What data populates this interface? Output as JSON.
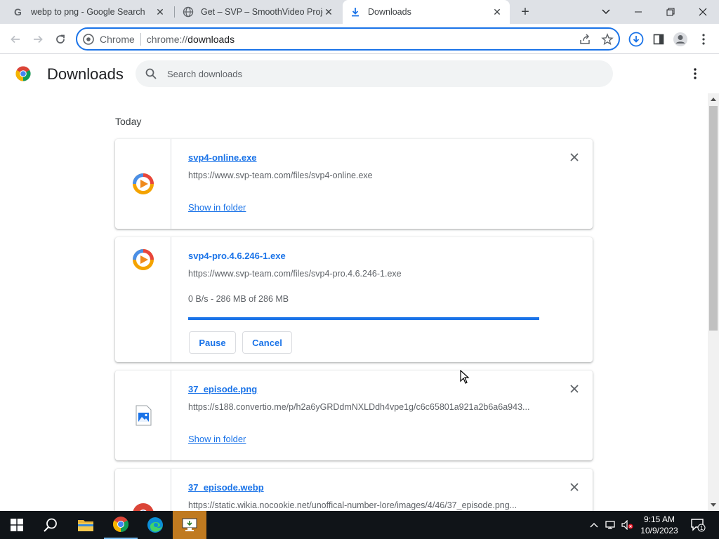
{
  "tabs": [
    {
      "title": "webp to png - Google Search",
      "icon": "google-icon",
      "active": false
    },
    {
      "title": "Get – SVP – SmoothVideo Project",
      "icon": "globe-icon",
      "active": false
    },
    {
      "title": "Downloads",
      "icon": "download-icon",
      "active": true
    }
  ],
  "toolbar": {
    "chip_label": "Chrome",
    "url_scheme": "chrome://",
    "url_path": "downloads"
  },
  "downloads_page": {
    "title": "Downloads",
    "search_placeholder": "Search downloads",
    "section_label": "Today",
    "items": [
      {
        "filename": "svp4-online.exe",
        "url": "https://www.svp-team.com/files/svp4-online.exe",
        "action": "Show in folder",
        "icon": "svp-app-icon"
      },
      {
        "filename": "svp4-pro.4.6.246-1.exe",
        "url": "https://www.svp-team.com/files/svp4-pro.4.6.246-1.exe",
        "status": "0 B/s - 286 MB of 286 MB",
        "progress": 1.0,
        "pause_label": "Pause",
        "cancel_label": "Cancel",
        "icon": "svp-app-icon"
      },
      {
        "filename": "37_episode.png",
        "url": "https://s188.convertio.me/p/h2a6yGRDdmNXLDdh4vpe1g/c6c65801a921a2b6a6a943...",
        "action": "Show in folder",
        "icon": "image-file-icon"
      },
      {
        "filename": "37_episode.webp",
        "url": "https://static.wikia.nocookie.net/unoffical-number-lore/images/4/46/37_episode.png...",
        "icon": "chrome-file-icon"
      }
    ]
  },
  "taskbar": {
    "time": "9:15 AM",
    "date": "10/9/2023",
    "notification_count": "1"
  },
  "colors": {
    "accent": "#1a73e8",
    "tabstrip": "#dee1e6",
    "taskbar": "#101418"
  }
}
